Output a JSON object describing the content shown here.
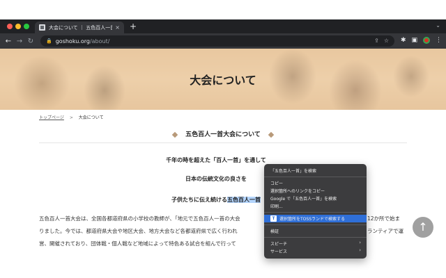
{
  "browser": {
    "tab_title": "大会について ｜ 五色百人一首大会",
    "tab_close": "×",
    "new_tab": "+",
    "url_host": "goshoku.org",
    "url_path": "/about/"
  },
  "hero": {
    "title": "大会について"
  },
  "breadcrumb": {
    "home": "トップページ",
    "separator": ">",
    "current": "大会について"
  },
  "section": {
    "title": "五色百人一首大会について"
  },
  "poem": {
    "line1": "千年の時を超えた「百人一首」を通して",
    "line2": "日本の伝統文化の良さを",
    "line3_prefix": "子供たちに伝え続ける",
    "line3_highlight": "五色百人一首"
  },
  "paragraph": {
    "p1": "五色百人一首大会は、全国各都道府県の小学校の教師が、「地元で五色百人一首の大会",
    "p1_tail": "12か所で始ま",
    "p2": "りました。今では、都道府県大会や地区大会、地方大会など各都道府県で広く行われ",
    "p2_tail": "ランティアで運",
    "p3": "営、開催されており、団体戦・個人戦など地域によって特色ある試合を組んで行って"
  },
  "scroll_top": {
    "icon": "↑"
  },
  "context_menu": {
    "search_top": "「五色百人一首」を検索",
    "copy": "コピー",
    "copy_link": "選択箇所へのリンクをコピー",
    "google_search": "Google で「五色百人一首」を検索",
    "print": "印刷...",
    "toss_search": "選択箇所をTOSSランドで検索する",
    "toss_logo": "T",
    "inspect": "検証",
    "speech": "スピーチ",
    "services": "サービス",
    "submenu_arrow": "›"
  },
  "colors": {
    "tab_strip": "#202124",
    "toolbar": "#35363a",
    "hero_tint": "#e4c49c",
    "selection": "#b3d4fc",
    "menu_highlight": "#2f6fd8",
    "scroll_button": "#a0a0a0"
  }
}
